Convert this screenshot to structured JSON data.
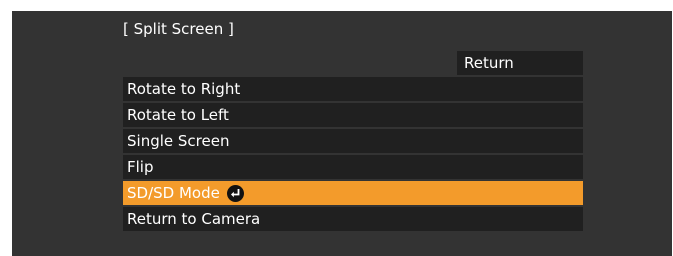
{
  "title": "[ Split Screen ]",
  "return_label": "Return",
  "menu": {
    "items": [
      {
        "label": "Rotate to Right"
      },
      {
        "label": "Rotate to Left"
      },
      {
        "label": "Single Screen"
      },
      {
        "label": "Flip"
      },
      {
        "label": "SD/SD Mode",
        "selected": true,
        "icon": "enter-icon"
      },
      {
        "label": "Return to Camera"
      }
    ]
  },
  "colors": {
    "panel_bg": "#333333",
    "item_bg": "#202020",
    "selected_bg": "#f39b2b",
    "text": "#ffffff"
  }
}
